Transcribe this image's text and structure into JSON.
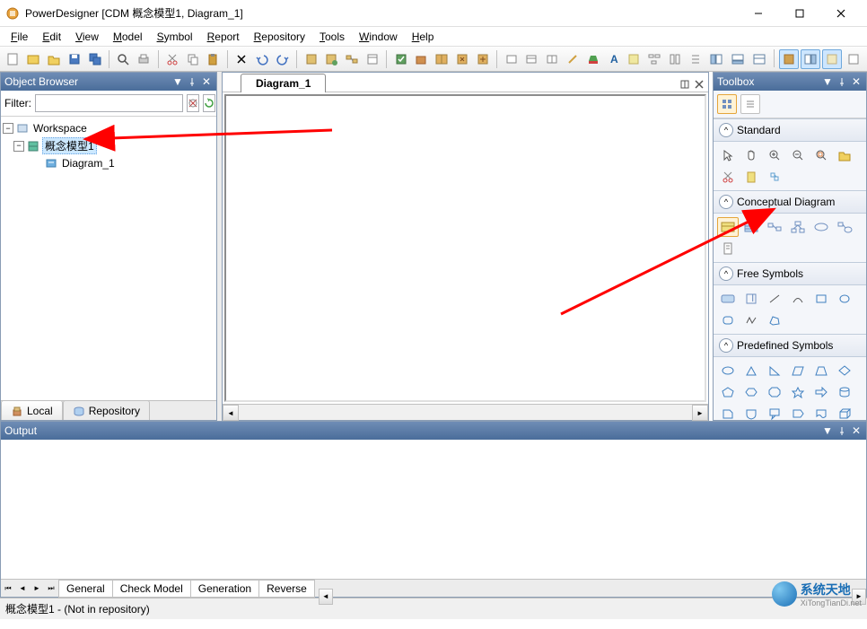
{
  "window": {
    "title": "PowerDesigner [CDM 概念模型1, Diagram_1]"
  },
  "menu": {
    "items": [
      "File",
      "Edit",
      "View",
      "Model",
      "Symbol",
      "Report",
      "Repository",
      "Tools",
      "Window",
      "Help"
    ]
  },
  "objectBrowser": {
    "title": "Object Browser",
    "filterLabel": "Filter:",
    "filterValue": "",
    "tree": {
      "root": "Workspace",
      "model": "概念模型1",
      "diagram": "Diagram_1"
    },
    "tabs": {
      "local": "Local",
      "repository": "Repository"
    }
  },
  "diagram": {
    "tab": "Diagram_1"
  },
  "toolbox": {
    "title": "Toolbox",
    "sections": {
      "standard": "Standard",
      "conceptual": "Conceptual Diagram",
      "freeSymbols": "Free Symbols",
      "predefined": "Predefined Symbols"
    }
  },
  "output": {
    "title": "Output",
    "tabs": [
      "General",
      "Check Model",
      "Generation",
      "Reverse"
    ]
  },
  "statusbar": {
    "text": "概念模型1 - (Not in repository)"
  },
  "watermark": {
    "line1": "系统天地",
    "line2": "XiTongTianDi.net"
  }
}
